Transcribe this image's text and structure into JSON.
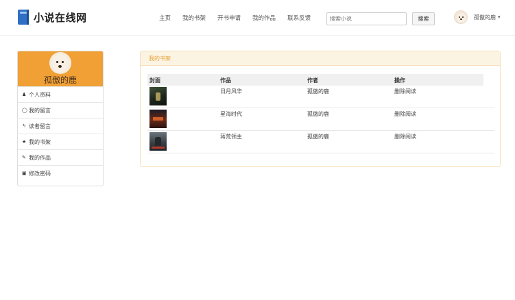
{
  "brand": {
    "title": "小说在线网"
  },
  "nav": {
    "links": [
      {
        "label": "主页"
      },
      {
        "label": "我的书架"
      },
      {
        "label": "开书申请"
      },
      {
        "label": "我的作品"
      },
      {
        "label": "联系反馈"
      }
    ],
    "search_placeholder": "搜索小说",
    "search_button": "搜索",
    "username": "孤傲的鹿",
    "caret": "▾"
  },
  "sidebar": {
    "profile_name": "孤傲的鹿",
    "items": [
      {
        "icon": "user-icon",
        "glyph": "👤",
        "label": "个人资料"
      },
      {
        "icon": "comment-icon",
        "glyph": "◯",
        "label": "我的留言"
      },
      {
        "icon": "reply-icon",
        "glyph": "↰",
        "label": "读者留言"
      },
      {
        "icon": "star-icon",
        "glyph": "★",
        "label": "我的书架"
      },
      {
        "icon": "book-icon",
        "glyph": "✎",
        "label": "我的作品"
      },
      {
        "icon": "lock-icon",
        "glyph": "🔒",
        "label": "修改密码"
      }
    ]
  },
  "bookshelf": {
    "title": "我的书架",
    "columns": [
      "封面",
      "作品",
      "作者",
      "操作"
    ],
    "rows": [
      {
        "title": "日月风华",
        "author": "孤傲的鹿",
        "actions": "删除阅读",
        "cover_color": "#2b3a2a"
      },
      {
        "title": "星海时代",
        "author": "孤傲的鹿",
        "actions": "删除阅读",
        "cover_color": "#4a1e16"
      },
      {
        "title": "蒋荒领主",
        "author": "孤傲的鹿",
        "actions": "删除阅读",
        "cover_color": "#3a3f44"
      }
    ]
  },
  "colors": {
    "accent_orange": "#f0a035",
    "panel_border": "#f7dfb8",
    "panel_header_bg": "#fcf4e3",
    "brand_blue": "#2f6fc4"
  }
}
